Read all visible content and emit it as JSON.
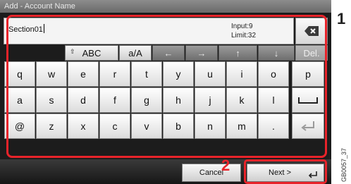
{
  "title_bar": {
    "title": "Add - Account Name"
  },
  "input": {
    "value": "Section01",
    "count_label": "Input:9",
    "limit_label": "Limit:32",
    "backspace_icon": "backspace-icon"
  },
  "mode_row": {
    "shift_glyph": "⇧",
    "abc_label": "ABC",
    "case_label": "a/A",
    "left_arrow": "←",
    "right_arrow": "→",
    "up_arrow": "↑",
    "down_arrow": "↓",
    "delete_label": "Del."
  },
  "keys": {
    "row1": [
      "q",
      "w",
      "e",
      "r",
      "t",
      "y",
      "u",
      "i",
      "o",
      "p"
    ],
    "row2": [
      "a",
      "s",
      "d",
      "f",
      "g",
      "h",
      "j",
      "k",
      "l"
    ],
    "row3": [
      "@",
      "z",
      "x",
      "c",
      "v",
      "b",
      "n",
      "m",
      "."
    ],
    "space_icon": "space-icon",
    "enter_icon": "enter-icon"
  },
  "buttons": {
    "cancel_label": "Cancel",
    "next_label": "Next >",
    "next_icon": "enter-icon"
  },
  "callouts": {
    "one": "1",
    "two": "2"
  },
  "image_code": "GB0057_37",
  "colors": {
    "highlight": "#e8232a",
    "panel": "#1c1c1c"
  }
}
